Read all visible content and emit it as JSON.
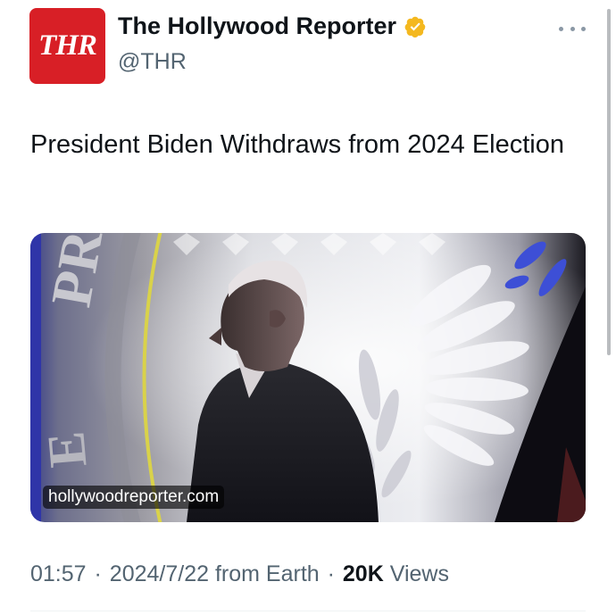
{
  "author": {
    "avatar_text": "THR",
    "display_name": "The Hollywood Reporter",
    "handle": "@THR",
    "verified": true,
    "verified_color": "#f4b81f"
  },
  "tweet": {
    "text": "President Biden Withdraws from 2024 Election"
  },
  "media": {
    "link_domain": "hollywoodreporter.com"
  },
  "meta": {
    "time": "01:57",
    "separator": "·",
    "date": "2024/7/22",
    "location": "from Earth",
    "views_count": "20K",
    "views_label": "Views"
  },
  "colors": {
    "brand_red": "#d81f26",
    "text_primary": "#0f1419",
    "text_secondary": "#536471"
  },
  "icons": {
    "verified": "verified-badge-icon",
    "more": "more-options-icon"
  }
}
